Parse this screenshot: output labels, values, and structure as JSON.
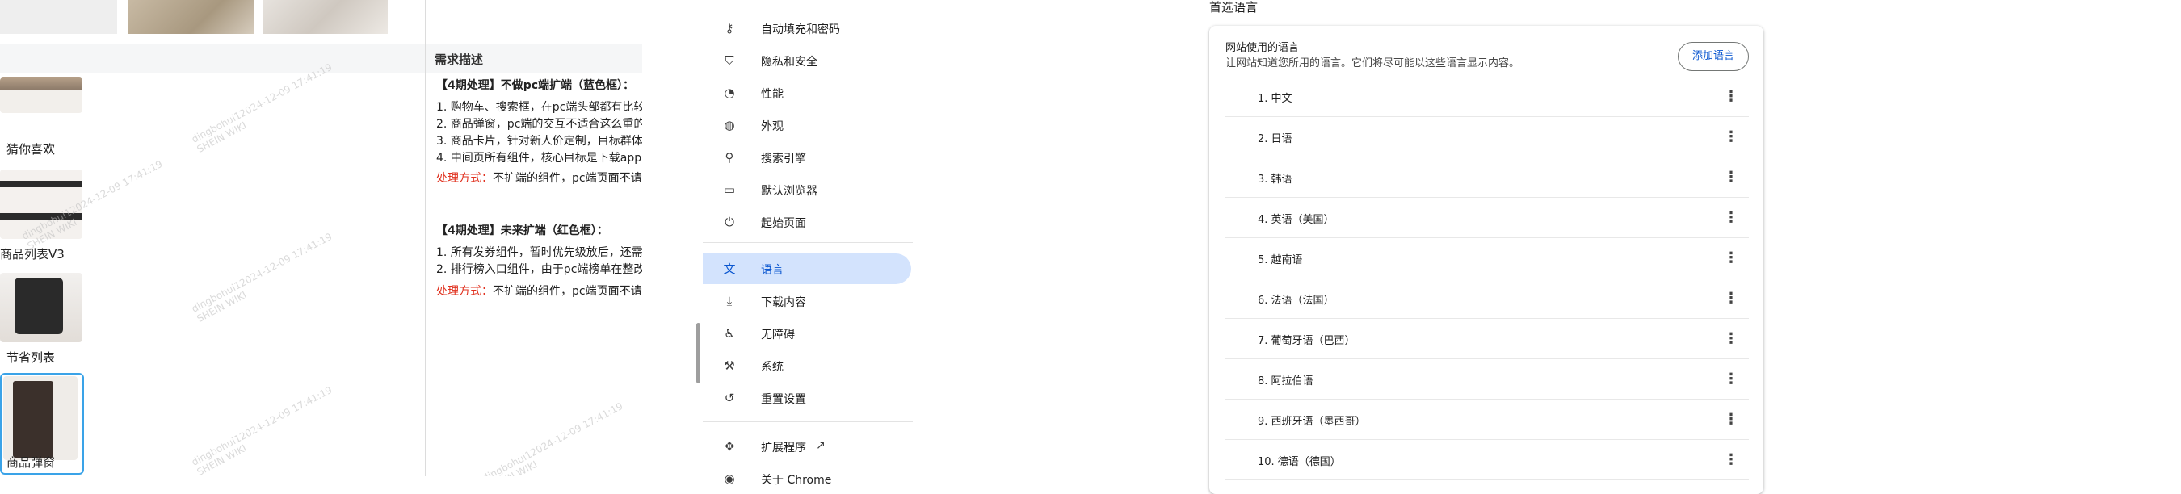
{
  "doc": {
    "column_header": "需求描述",
    "components": [
      {
        "label": "猜你喜欢"
      },
      {
        "label": "商品列表V3"
      },
      {
        "label": "节省列表"
      },
      {
        "label": "商品弹窗"
      }
    ],
    "req_block1": {
      "title": "【4期处理】不做pc端扩端（蓝色框）：",
      "lines": [
        "1. 购物车、搜索框，在pc端头部都有比较",
        "2. 商品弹窗，pc端的交互不适合这么重的",
        "3. 商品卡片，针对新人价定制，目标群体",
        "4. 中间页所有组件，核心目标是下载app"
      ],
      "method_label": "处理方式：",
      "method_text": "不扩端的组件，pc端页面不请求"
    },
    "req_block2": {
      "title": "【4期处理】未来扩端（红色框）：",
      "lines": [
        "1. 所有发券组件，暂时优先级放后，还需",
        "2. 排行榜入口组件，由于pc端榜单在整改"
      ],
      "method_label": "处理方式：",
      "method_text": "不扩端的组件，pc端页面不请求"
    },
    "watermarks": [
      "dingbohui12024-12-09 17:41:19",
      "SHEIN WIKI"
    ]
  },
  "nav": {
    "items": [
      {
        "label": "自动填充和密码",
        "icon": "key-icon"
      },
      {
        "label": "隐私和安全",
        "icon": "shield-icon"
      },
      {
        "label": "性能",
        "icon": "speedometer-icon"
      },
      {
        "label": "外观",
        "icon": "palette-icon"
      },
      {
        "label": "搜索引擎",
        "icon": "search-icon"
      },
      {
        "label": "默认浏览器",
        "icon": "browser-window-icon"
      },
      {
        "label": "起始页面",
        "icon": "power-icon"
      },
      {
        "label": "语言",
        "icon": "translate-icon"
      },
      {
        "label": "下载内容",
        "icon": "download-icon"
      },
      {
        "label": "无障碍",
        "icon": "accessibility-icon"
      },
      {
        "label": "系统",
        "icon": "wrench-icon"
      },
      {
        "label": "重置设置",
        "icon": "reset-icon"
      },
      {
        "label": "扩展程序",
        "icon": "puzzle-icon"
      },
      {
        "label": "关于 Chrome",
        "icon": "chrome-icon"
      }
    ],
    "active": "语言"
  },
  "languages": {
    "section_title": "首选语言",
    "card_title": "网站使用的语言",
    "card_subtitle": "让网站知道您所用的语言。它们将尽可能以这些语言显示内容。",
    "add_button": "添加语言",
    "list": [
      "1. 中文",
      "2. 日语",
      "3. 韩语",
      "4. 英语（美国）",
      "5. 越南语",
      "6. 法语（法国）",
      "7. 葡萄牙语（巴西）",
      "8. 阿拉伯语",
      "9. 西班牙语（墨西哥）",
      "10. 德语（德国）"
    ]
  },
  "colors": {
    "accent": "#0b57d0",
    "active_nav_bg": "#d3e3fd",
    "selection_border": "#3aa3e8",
    "method_label": "#e0311f"
  }
}
